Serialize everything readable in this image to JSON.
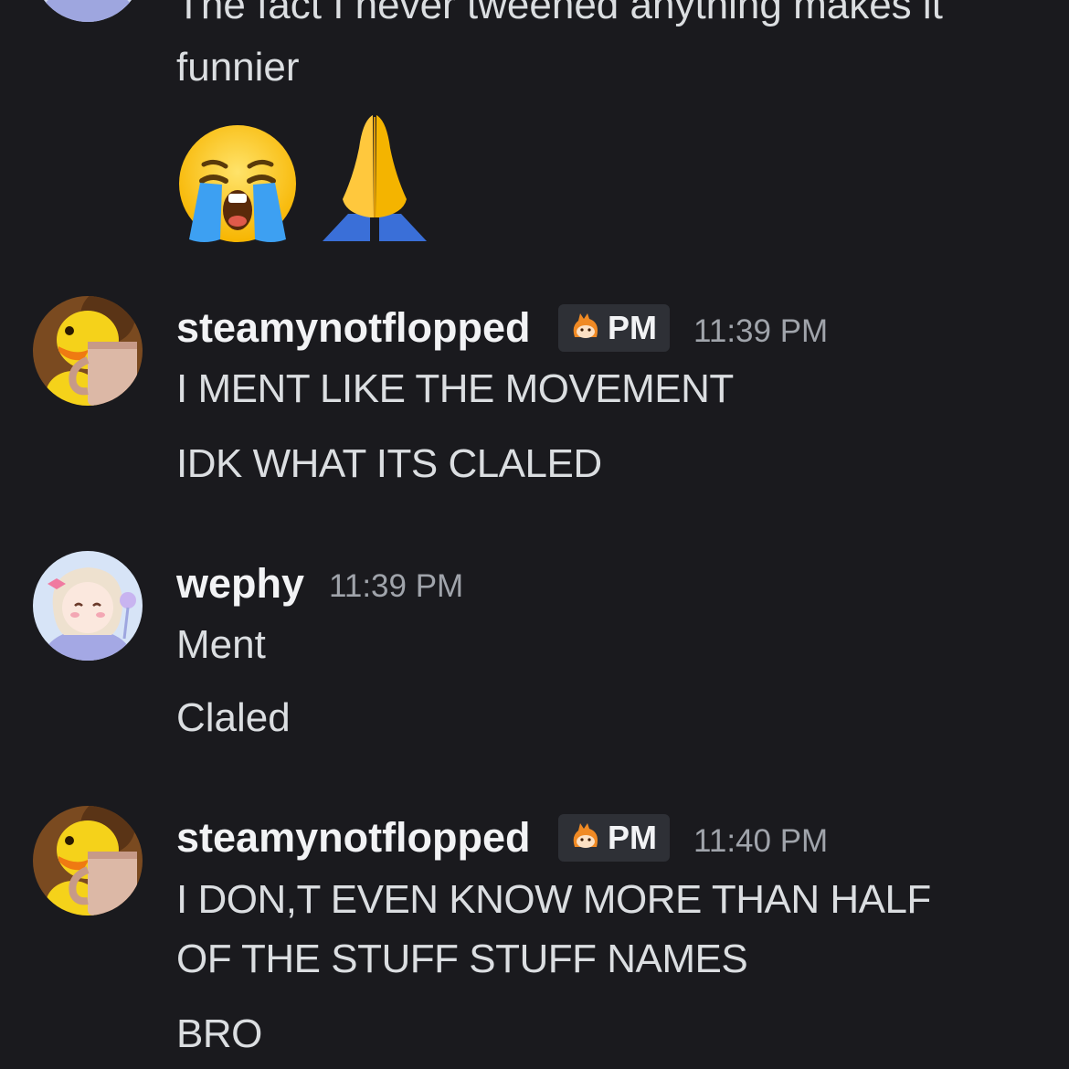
{
  "messages": {
    "top": {
      "text_line1": "The fact I never tweened anything makes it",
      "text_line2": "funnier",
      "reactions": [
        "loudly-crying-face-icon",
        "folded-hands-icon"
      ]
    },
    "msg1": {
      "username": "steamynotflopped",
      "badge": "PM",
      "timestamp": "11:39 PM",
      "line1": "I MENT LIKE THE MOVEMENT",
      "line2": "IDK WHAT ITS CLALED"
    },
    "msg2": {
      "username": "wephy",
      "timestamp": "11:39 PM",
      "line1": "Ment",
      "line2": "Claled"
    },
    "msg3": {
      "username": "steamynotflopped",
      "badge": "PM",
      "timestamp": "11:40 PM",
      "line1": "I DON,T EVEN KNOW MORE THAN HALF",
      "line2": "OF THE STUFF STUFF NAMES",
      "line3": "BRO"
    }
  },
  "colors": {
    "background": "#1a1a1e",
    "text": "#dbdee1",
    "username": "#f2f3f5",
    "timestamp": "#a0a4ab",
    "badge_bg": "#2e3036"
  }
}
